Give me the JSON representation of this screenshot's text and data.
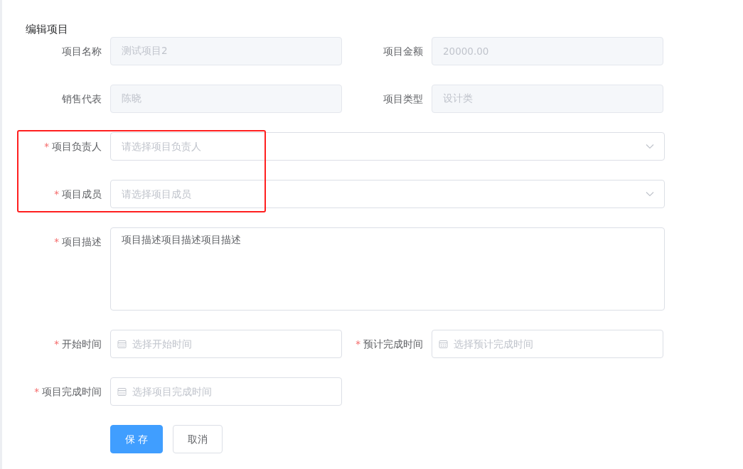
{
  "title": "编辑项目",
  "rows": [
    {
      "highlighted": false,
      "fields": [
        {
          "label": "项目名称",
          "kind": "input",
          "disabled": true,
          "value": "测试项目2"
        },
        {
          "label": "项目金额",
          "kind": "input",
          "disabled": true,
          "value": "20000.00"
        }
      ]
    },
    {
      "highlighted": false,
      "fields": [
        {
          "label": "销售代表",
          "kind": "input",
          "disabled": true,
          "value": "陈晓"
        },
        {
          "label": "项目类型",
          "kind": "input",
          "disabled": true,
          "value": "设计类"
        }
      ]
    },
    {
      "highlighted": true,
      "fields": [
        {
          "label": "项目负责人",
          "required_mark": "*",
          "kind": "select",
          "disabled": false,
          "placeholder": "请选择项目负责人"
        }
      ]
    },
    {
      "highlighted": true,
      "fields": [
        {
          "label": "项目成员",
          "required_mark": "*",
          "kind": "select",
          "disabled": false,
          "placeholder": "请选择项目成员"
        }
      ]
    },
    {
      "highlighted": false,
      "fields": [
        {
          "label": "项目描述",
          "required_mark": "*",
          "kind": "textarea",
          "disabled": false,
          "value": "项目描述项目描述项目描述"
        }
      ]
    },
    {
      "highlighted": false,
      "fields": [
        {
          "label": "开始时间",
          "required_mark": "*",
          "kind": "date",
          "disabled": false,
          "placeholder": "选择开始时间"
        },
        {
          "label": "预计完成时间",
          "required_mark": "*",
          "kind": "date",
          "disabled": false,
          "placeholder": "选择预计完成时间"
        }
      ]
    },
    {
      "highlighted": false,
      "fields": [
        {
          "label": "项目完成时间",
          "required_mark": "*",
          "kind": "date",
          "disabled": false,
          "placeholder": "选择项目完成时间"
        }
      ]
    }
  ],
  "buttons": [
    {
      "label": "保 存",
      "kind": "primary"
    },
    {
      "label": "取消",
      "kind": "default"
    }
  ]
}
